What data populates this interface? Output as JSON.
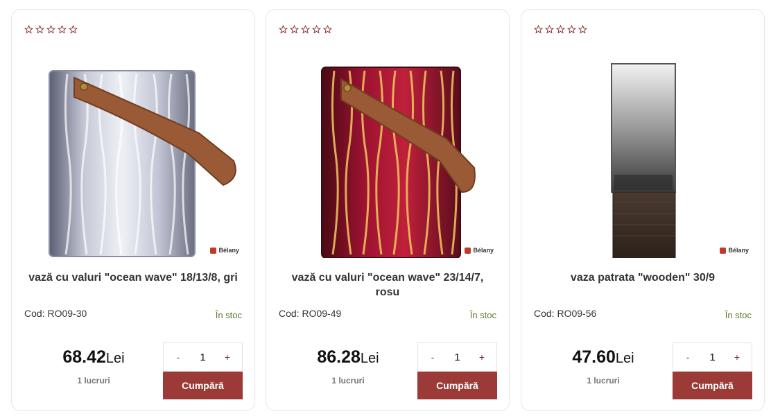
{
  "colors": {
    "accent": "#9b3a36",
    "stock": "#5f7a2f",
    "star_outline": "#8a2f2f"
  },
  "currency": "Lei",
  "products": [
    {
      "title": "vază cu valuri \"ocean wave\" 18/13/8, gri",
      "code": "Cod: RO09-30",
      "stock": "În stoc",
      "price": "68.42",
      "currency": "Lei",
      "units": "1 lucruri",
      "quantity": "1",
      "minus": "-",
      "plus": "+",
      "buy": "Cumpără",
      "brand": "Bélany",
      "rating": 0,
      "image": "grey-wave-glass-vase"
    },
    {
      "title": "vază cu valuri \"ocean wave\" 23/14/7, rosu",
      "code": "Cod: RO09-49",
      "stock": "În stoc",
      "price": "86.28",
      "currency": "Lei",
      "units": "1 lucruri",
      "quantity": "1",
      "minus": "-",
      "plus": "+",
      "buy": "Cumpără",
      "brand": "Bélany",
      "rating": 0,
      "image": "red-wave-glass-vase"
    },
    {
      "title": "vaza patrata \"wooden\" 30/9",
      "code": "Cod: RO09-56",
      "stock": "În stoc",
      "price": "47.60",
      "currency": "Lei",
      "units": "1 lucruri",
      "quantity": "1",
      "minus": "-",
      "plus": "+",
      "buy": "Cumpără",
      "brand": "Bélany",
      "rating": 0,
      "image": "smoked-glass-wooden-vase"
    }
  ]
}
